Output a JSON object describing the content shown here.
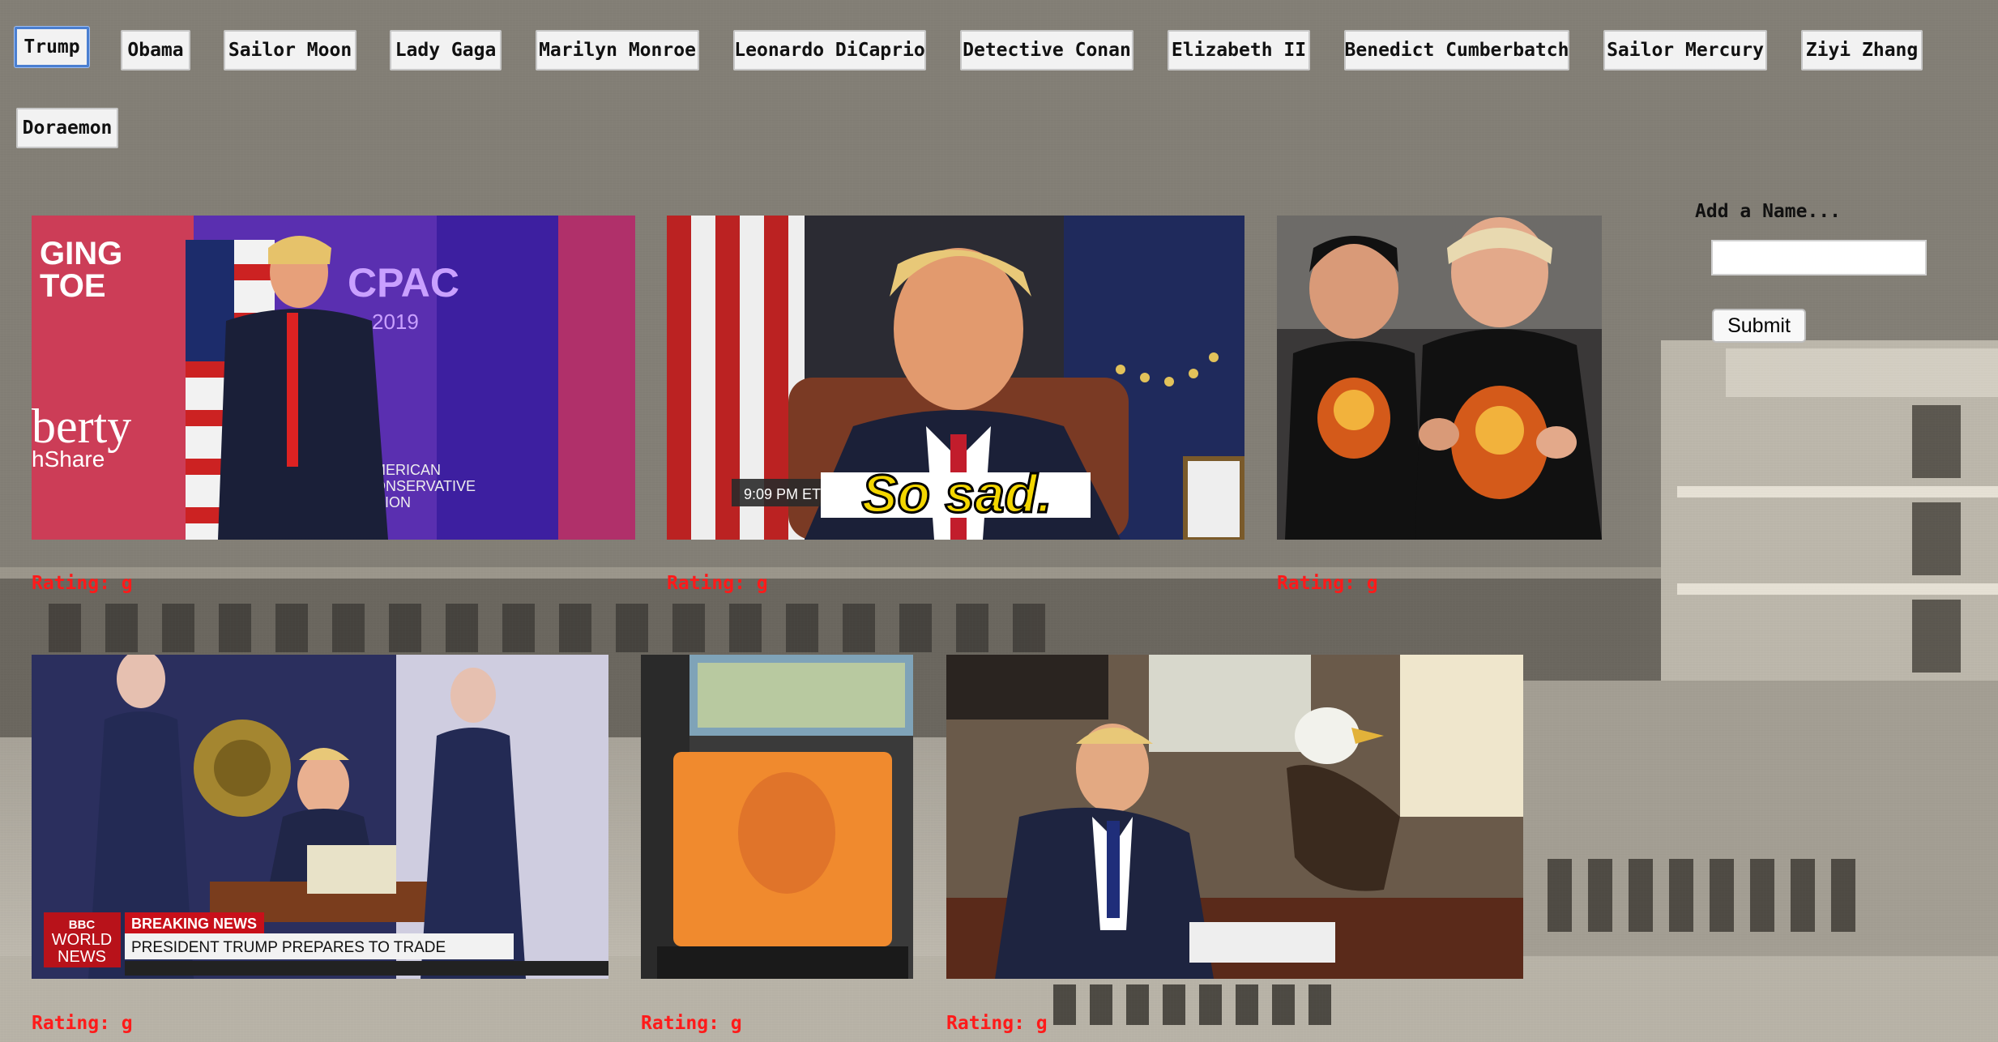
{
  "tabs": [
    {
      "label": "Trump",
      "active": true
    },
    {
      "label": "Obama"
    },
    {
      "label": "Sailor Moon"
    },
    {
      "label": "Lady Gaga"
    },
    {
      "label": "Marilyn Monroe"
    },
    {
      "label": "Leonardo DiCaprio"
    },
    {
      "label": "Detective Conan"
    },
    {
      "label": "Elizabeth II"
    },
    {
      "label": "Benedict Cumberbatch"
    },
    {
      "label": "Sailor Mercury"
    },
    {
      "label": "Ziyi Zhang"
    },
    {
      "label": "Doraemon"
    }
  ],
  "gifs": [
    {
      "rating": "Rating: g",
      "overlay": "",
      "description": "Trump hugging flag at CPAC 2019"
    },
    {
      "rating": "Rating: g",
      "overlay": "So sad.",
      "timestamp": "9:09 PM ET"
    },
    {
      "rating": "Rating: g",
      "overlay": ""
    },
    {
      "rating": "Rating: g",
      "overlay": "PRESIDENT TRUMP PREPARES TO TRADE",
      "banner": "BREAKING NEWS",
      "channel": "BBC WORLD NEWS"
    },
    {
      "rating": "Rating: g",
      "overlay": ""
    },
    {
      "rating": "Rating: g",
      "overlay": ""
    }
  ],
  "form": {
    "label": "Add a Name...",
    "input_value": "",
    "submit_label": "Submit"
  },
  "colors": {
    "rating": "#ff1a1a",
    "active_tab_border": "#4a7fd1"
  }
}
